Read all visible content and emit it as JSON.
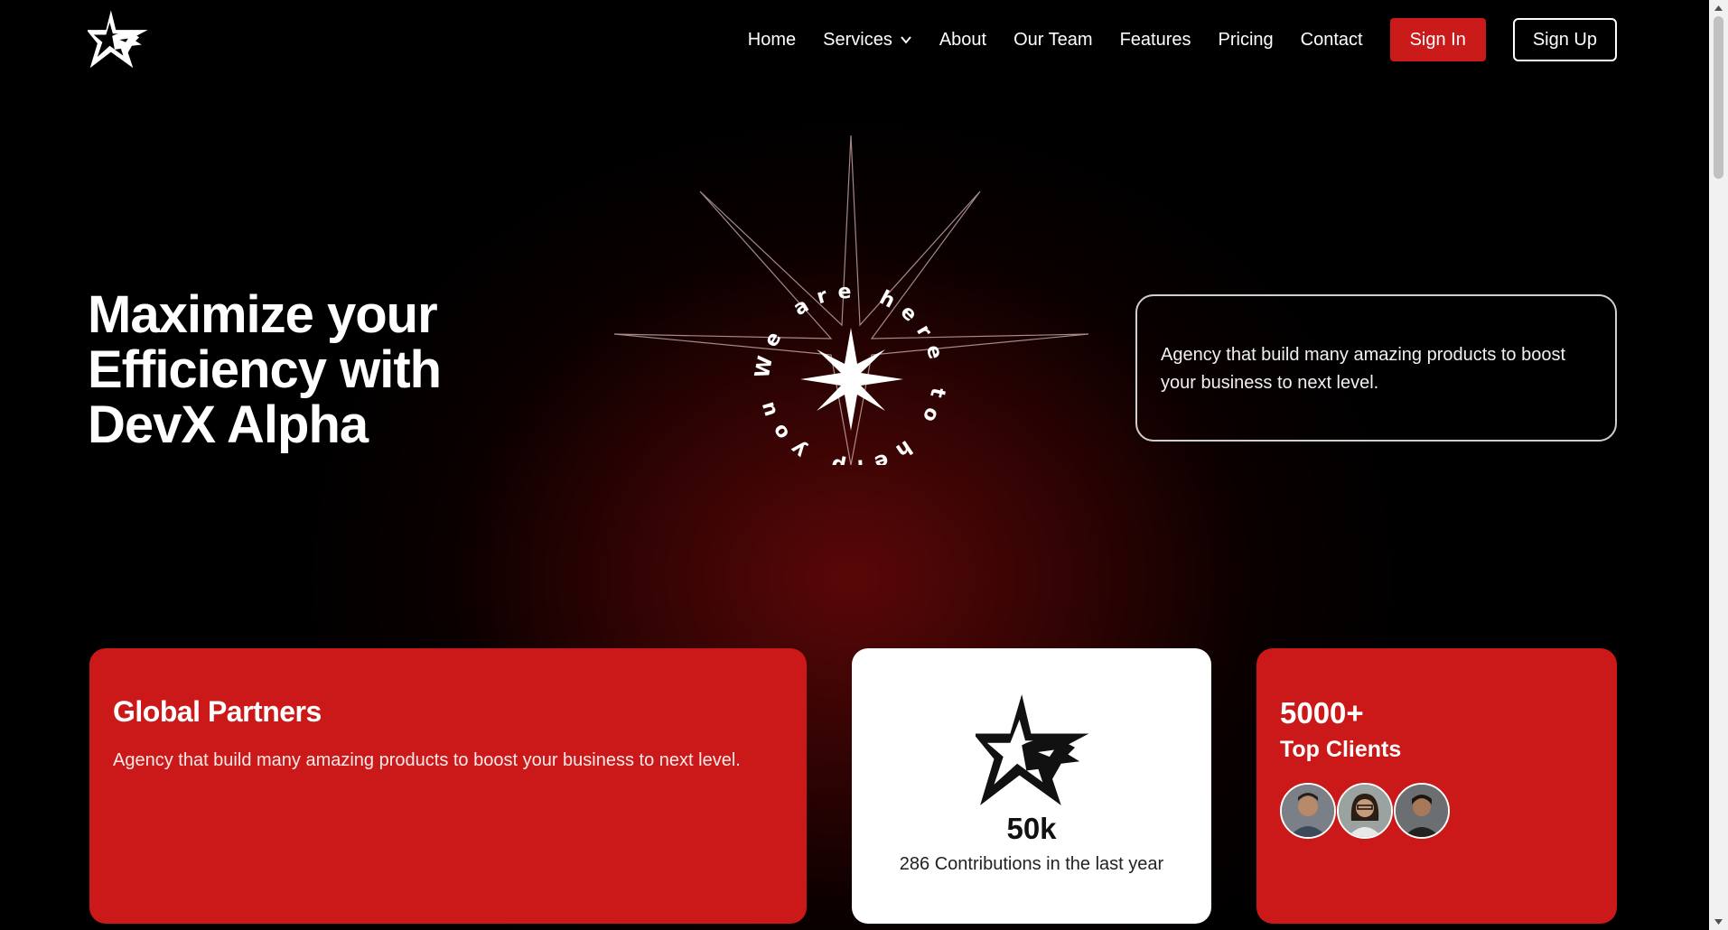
{
  "nav": {
    "items": [
      "Home",
      "Services",
      "About",
      "Our Team",
      "Features",
      "Pricing",
      "Contact"
    ],
    "signin_label": "Sign In",
    "signup_label": "Sign Up"
  },
  "hero": {
    "title_line1": "Maximize your",
    "title_line2": "Efficiency with",
    "title_line3": "DevX Alpha",
    "circle_text": "We are here to help you",
    "card_text": "Agency that build many amazing products to boost your business to next level."
  },
  "cards": {
    "partners": {
      "title": "Global Partners",
      "text": "Agency that build many amazing products to boost your business to next level."
    },
    "stats": {
      "value": "50k",
      "subtitle": "286 Contributions in the last year"
    },
    "clients": {
      "count": "5000+",
      "label": "Top Clients"
    }
  },
  "colors": {
    "accent": "#cb1818",
    "background": "#000000",
    "card_white": "#ffffff"
  }
}
